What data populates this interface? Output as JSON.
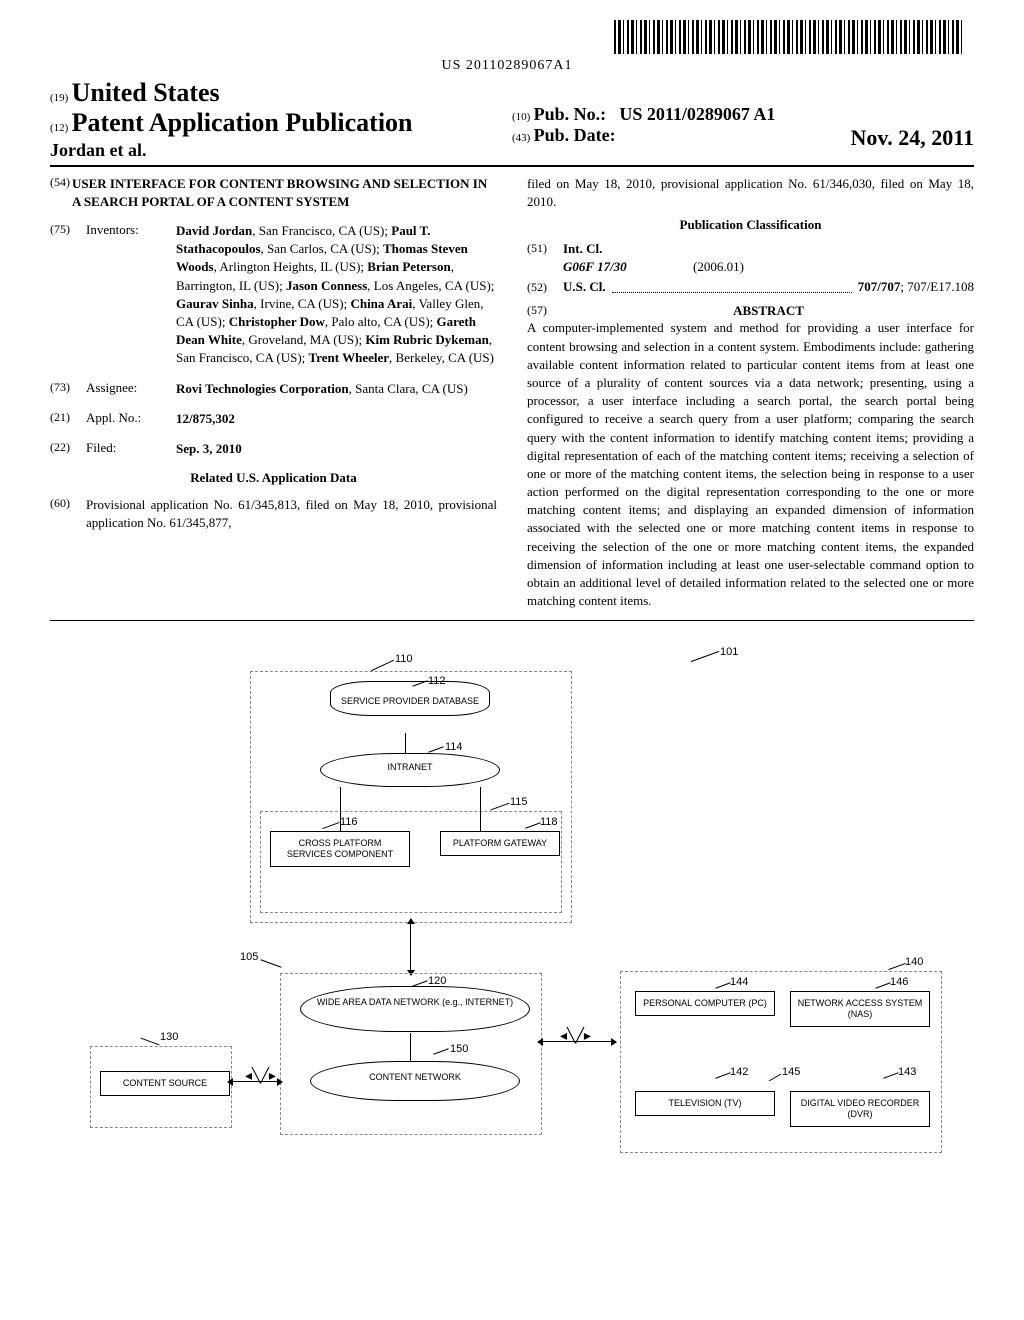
{
  "barcode_number": "US 20110289067A1",
  "header": {
    "inid19": "(19)",
    "country": "United States",
    "inid12": "(12)",
    "pub_type": "Patent Application Publication",
    "authors": "Jordan et al.",
    "inid10": "(10)",
    "pub_no_label": "Pub. No.:",
    "pub_no_value": "US 2011/0289067 A1",
    "inid43": "(43)",
    "pub_date_label": "Pub. Date:",
    "pub_date_value": "Nov. 24, 2011"
  },
  "title": {
    "inid": "(54)",
    "text": "USER INTERFACE FOR CONTENT BROWSING AND SELECTION IN A SEARCH PORTAL OF A CONTENT SYSTEM"
  },
  "inventors": {
    "inid": "(75)",
    "label": "Inventors:",
    "list": [
      {
        "name": "David Jordan",
        "loc": ", San Francisco, CA (US); "
      },
      {
        "name": "Paul T. Stathacopoulos",
        "loc": ", San Carlos, CA (US); "
      },
      {
        "name": "Thomas Steven Woods",
        "loc": ", Arlington Heights, IL (US); "
      },
      {
        "name": "Brian Peterson",
        "loc": ", Barrington, IL (US); "
      },
      {
        "name": "Jason Conness",
        "loc": ", Los Angeles, CA (US); "
      },
      {
        "name": "Gaurav Sinha",
        "loc": ", Irvine, CA (US); "
      },
      {
        "name": "China Arai",
        "loc": ", Valley Glen, CA (US); "
      },
      {
        "name": "Christopher Dow",
        "loc": ", Palo alto, CA (US); "
      },
      {
        "name": "Gareth Dean White",
        "loc": ", Groveland, MA (US); "
      },
      {
        "name": "Kim Rubric Dykeman",
        "loc": ", San Francisco, CA (US); "
      },
      {
        "name": "Trent Wheeler",
        "loc": ", Berkeley, CA (US)"
      }
    ]
  },
  "assignee": {
    "inid": "(73)",
    "label": "Assignee:",
    "name": "Rovi Technologies Corporation",
    "loc": ", Santa Clara, CA (US)"
  },
  "appl_no": {
    "inid": "(21)",
    "label": "Appl. No.:",
    "value": "12/875,302"
  },
  "filed": {
    "inid": "(22)",
    "label": "Filed:",
    "value": "Sep. 3, 2010"
  },
  "related": {
    "title": "Related U.S. Application Data",
    "inid": "(60)",
    "text": "Provisional application No. 61/345,813, filed on May 18, 2010, provisional application No. 61/345,877, filed on May 18, 2010, provisional application No. 61/346,030, filed on May 18, 2010."
  },
  "classification": {
    "title": "Publication Classification",
    "intcl_inid": "(51)",
    "intcl_label": "Int. Cl.",
    "intcl_code": "G06F 17/30",
    "intcl_date": "(2006.01)",
    "uscl_inid": "(52)",
    "uscl_label": "U.S. Cl.",
    "uscl_value_bold": "707/707",
    "uscl_value_rest": "; 707/E17.108"
  },
  "abstract": {
    "inid": "(57)",
    "title": "ABSTRACT",
    "text": "A computer-implemented system and method for providing a user interface for content browsing and selection in a content system. Embodiments include: gathering available content information related to particular content items from at least one source of a plurality of content sources via a data network; presenting, using a processor, a user interface including a search portal, the search portal being configured to receive a search query from a user platform; comparing the search query with the content information to identify matching content items; providing a digital representation of each of the matching content items; receiving a selection of one or more of the matching content items, the selection being in response to a user action performed on the digital representation corresponding to the one or more matching content items; and displaying an expanded dimension of information associated with the selected one or more matching content items in response to receiving the selection of the one or more matching content items, the expanded dimension of information including at least one user-selectable command option to obtain an additional level of detailed information related to the selected one or more matching content items."
  },
  "figure": {
    "ref101": "101",
    "ref110": "110",
    "ref112": "112",
    "ref114": "114",
    "ref115": "115",
    "ref116": "116",
    "ref118": "118",
    "ref105": "105",
    "ref120": "120",
    "ref150": "150",
    "ref130": "130",
    "ref140": "140",
    "ref142": "142",
    "ref143": "143",
    "ref144": "144",
    "ref145": "145",
    "ref146": "146",
    "service_db": "SERVICE PROVIDER DATABASE",
    "intranet": "INTRANET",
    "cross_platform": "CROSS PLATFORM SERVICES COMPONENT",
    "platform_gateway": "PLATFORM GATEWAY",
    "wan": "WIDE AREA DATA NETWORK (e.g., INTERNET)",
    "content_network": "CONTENT NETWORK",
    "content_source": "CONTENT SOURCE",
    "pc": "PERSONAL COMPUTER (PC)",
    "nas": "NETWORK ACCESS SYSTEM (NAS)",
    "tv": "TELEVISION (TV)",
    "dvr": "DIGITAL VIDEO RECORDER (DVR)"
  }
}
